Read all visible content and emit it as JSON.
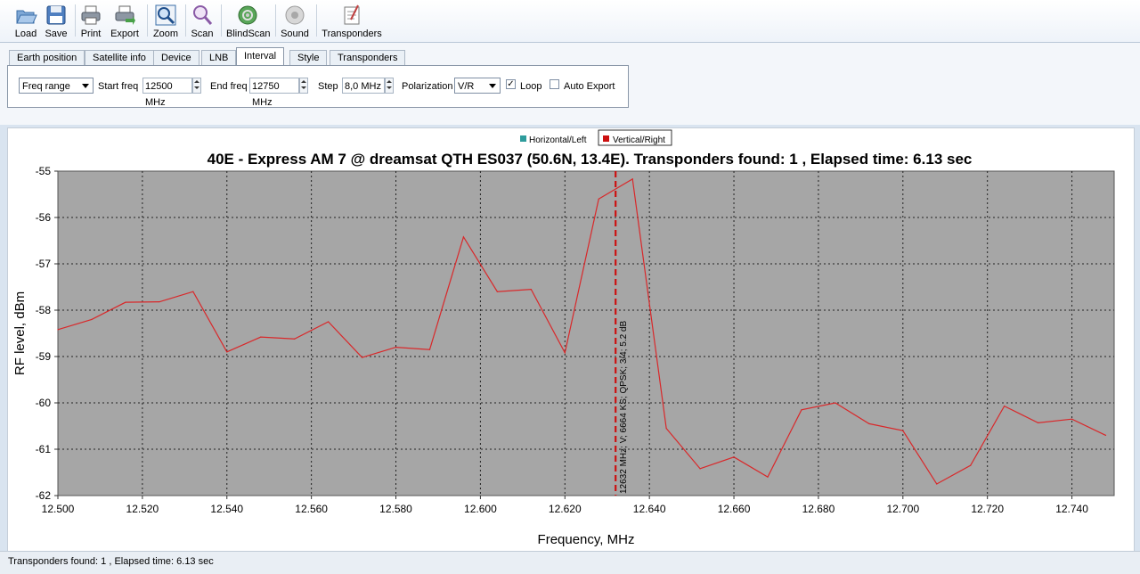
{
  "toolbar": {
    "buttons": [
      {
        "label": "Load",
        "icon": "folder-open-icon"
      },
      {
        "label": "Save",
        "icon": "floppy-disk-icon"
      },
      {
        "label": "Print",
        "icon": "printer-icon"
      },
      {
        "label": "Export",
        "icon": "export-printer-icon"
      },
      {
        "label": "Zoom",
        "icon": "magnifier-icon"
      },
      {
        "label": "Scan",
        "icon": "scan-icon"
      },
      {
        "label": "BlindScan",
        "icon": "globe-scan-icon"
      },
      {
        "label": "Sound",
        "icon": "speaker-icon"
      },
      {
        "label": "Transponders",
        "icon": "transponder-list-icon"
      }
    ]
  },
  "tabs": [
    "Earth position",
    "Satellite info",
    "Device",
    "LNB",
    "Interval",
    "Style",
    "Transponders"
  ],
  "active_tab": "Interval",
  "interval": {
    "mode": "Freq range",
    "start_label": "Start freq",
    "start_value": "12500 MHz",
    "end_label": "End freq",
    "end_value": "12750 MHz",
    "step_label": "Step",
    "step_value": "8,0 MHz",
    "pol_label": "Polarization",
    "pol_value": "V/R",
    "loop_label": "Loop",
    "loop_checked": true,
    "auto_export_label": "Auto Export",
    "auto_export_checked": false
  },
  "colors": {
    "plot_bg": "#a6a6a6",
    "line": "#d9282a",
    "marker": "#cc1111",
    "legend_h": "#2e9c9c"
  },
  "chart_data": {
    "type": "line",
    "title": "40E - Express AM 7 @ dreamsat QTH ES037 (50.6N, 13.4E). Transponders found: 1 , Elapsed time: 6.13 sec",
    "xlabel": "Frequency, MHz",
    "ylabel": "RF level, dBm",
    "xlim": [
      12.5,
      12.75
    ],
    "ylim": [
      -62,
      -55
    ],
    "grid": true,
    "legend_position": "top-center",
    "x_ticks": [
      "12.500",
      "12.520",
      "12.540",
      "12.560",
      "12.580",
      "12.600",
      "12.620",
      "12.640",
      "12.660",
      "12.680",
      "12.700",
      "12.720",
      "12.740"
    ],
    "y_ticks": [
      "-55",
      "-56",
      "-57",
      "-58",
      "-59",
      "-60",
      "-61",
      "-62"
    ],
    "legend": [
      {
        "name": "Horizontal/Left"
      },
      {
        "name": "Vertical/Right"
      }
    ],
    "series": [
      {
        "name": "Vertical/Right",
        "x": [
          12.5,
          12.508,
          12.516,
          12.524,
          12.532,
          12.54,
          12.548,
          12.556,
          12.564,
          12.572,
          12.58,
          12.588,
          12.596,
          12.604,
          12.612,
          12.62,
          12.628,
          12.636,
          12.644,
          12.652,
          12.66,
          12.668,
          12.676,
          12.684,
          12.692,
          12.7,
          12.708,
          12.716,
          12.724,
          12.732,
          12.74,
          12.748
        ],
        "values": [
          -58.42,
          -58.2,
          -57.83,
          -57.82,
          -57.6,
          -58.9,
          -58.58,
          -58.62,
          -58.25,
          -59.02,
          -58.8,
          -58.85,
          -56.42,
          -57.6,
          -57.55,
          -58.92,
          -55.6,
          -55.17,
          -60.55,
          -61.42,
          -61.17,
          -61.6,
          -60.15,
          -60.0,
          -60.45,
          -60.6,
          -61.75,
          -61.35,
          -60.07,
          -60.43,
          -60.35,
          -60.7
        ]
      }
    ],
    "marker": {
      "x": 12.632,
      "label": "12632 MHz; V; 6664 KS; QPSK; 3/4; 5.2 dB"
    }
  },
  "status": {
    "text": "Transponders found: 1 , Elapsed time: 6.13 sec"
  }
}
